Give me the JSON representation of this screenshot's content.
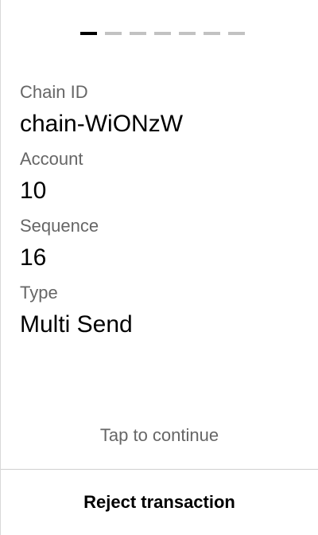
{
  "pager": {
    "total_steps": 7,
    "current_step": 1
  },
  "details": [
    {
      "label": "Chain ID",
      "value": "chain-WiONzW"
    },
    {
      "label": "Account",
      "value": "10"
    },
    {
      "label": "Sequence",
      "value": "16"
    },
    {
      "label": "Type",
      "value": "Multi Send"
    }
  ],
  "tap_hint": "Tap to continue",
  "reject_label": "Reject transaction",
  "colors": {
    "active_step": "#000000",
    "inactive_step": "#c2c2c2",
    "label_text": "#666666",
    "value_text": "#000000"
  }
}
